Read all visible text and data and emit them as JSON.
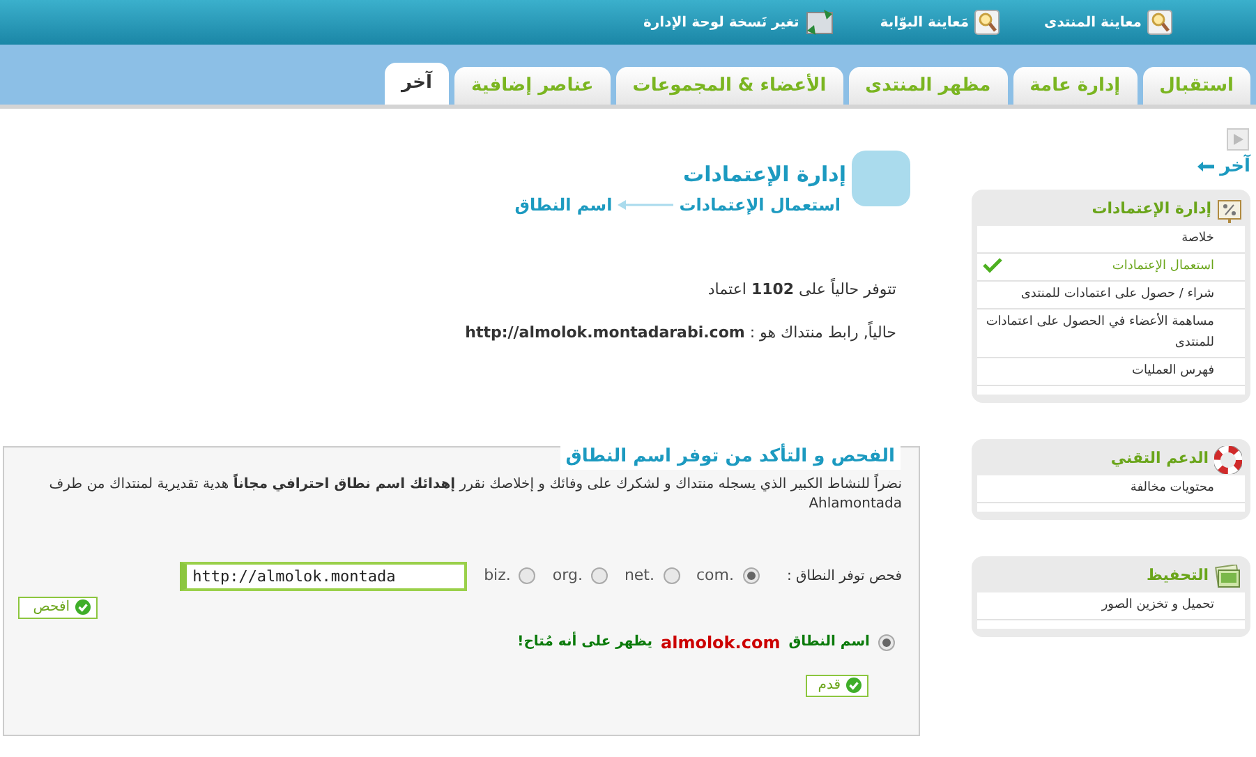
{
  "top_links": [
    {
      "label": "معاينة المنتدى",
      "kind": "preview"
    },
    {
      "label": "مَعاينة البوّابة",
      "kind": "preview"
    },
    {
      "label": "تغير نَسخة لوحة الإدارة",
      "kind": "version"
    }
  ],
  "tabs": [
    {
      "label": "استقبال",
      "selected": false
    },
    {
      "label": "إدارة عامة",
      "selected": false
    },
    {
      "label": "مظهر المنتدى",
      "selected": false
    },
    {
      "label": "الأعضاء & المجموعات",
      "selected": false
    },
    {
      "label": "عناصر إضافية",
      "selected": false
    },
    {
      "label": "آخر",
      "selected": true
    }
  ],
  "sidebar": {
    "back_link": "آخر",
    "boxes": [
      {
        "title": "إدارة الإعتمادات",
        "items": [
          {
            "label": "خلاصة",
            "selected": false
          },
          {
            "label": "استعمال الإعتمادات",
            "selected": true
          },
          {
            "label": "شراء / حصول على اعتمادات للمنتدى",
            "selected": false
          },
          {
            "label": "مساهمة الأعضاء في الحصول على اعتمادات للمنتدى",
            "selected": false
          },
          {
            "label": "فهرس العمليات",
            "selected": false
          }
        ]
      },
      {
        "title": "الدعم التقني",
        "items": [
          {
            "label": "محتويات مخالفة",
            "selected": false
          }
        ]
      },
      {
        "title": "التحفيظ",
        "items": [
          {
            "label": "تحميل و تخزين الصور",
            "selected": false
          }
        ]
      }
    ]
  },
  "page": {
    "title": "إدارة الإعتمادات",
    "breadcrumb": [
      "استعمال الإعتمادات",
      "اسم النطاق"
    ],
    "credits_line": "تتوفر حالياً على **1102** اعتماد",
    "link_line": "حالياً, رابط منتداك هو : **http://almolok.montadarabi.com**"
  },
  "domain_box": {
    "legend": "الفحص و التأكد من توفر اسم النطاق",
    "intro": "نضراً للنشاط الكبير الذي يسجله منتداك و لشكرك على وفائك و إخلاصك نقرر **إهدائك اسم نطاق احترافي** **مجاناً** هدية تقديرية لمنتداك من طرف Ahlamontada",
    "check_label": "فحص توفر النطاق :",
    "extensions": [
      {
        "label": ".com",
        "selected": true
      },
      {
        "label": ".net",
        "selected": false
      },
      {
        "label": ".org",
        "selected": false
      },
      {
        "label": ".biz",
        "selected": false
      }
    ],
    "domain_input": "http://almolok.montada",
    "check_button": "افحص",
    "result": {
      "selected": true,
      "prefix": "اسم النطاق",
      "domain": "almolok.com",
      "suffix": "يظهر على أنه مُتاح!"
    },
    "submit_button": "قدم"
  }
}
